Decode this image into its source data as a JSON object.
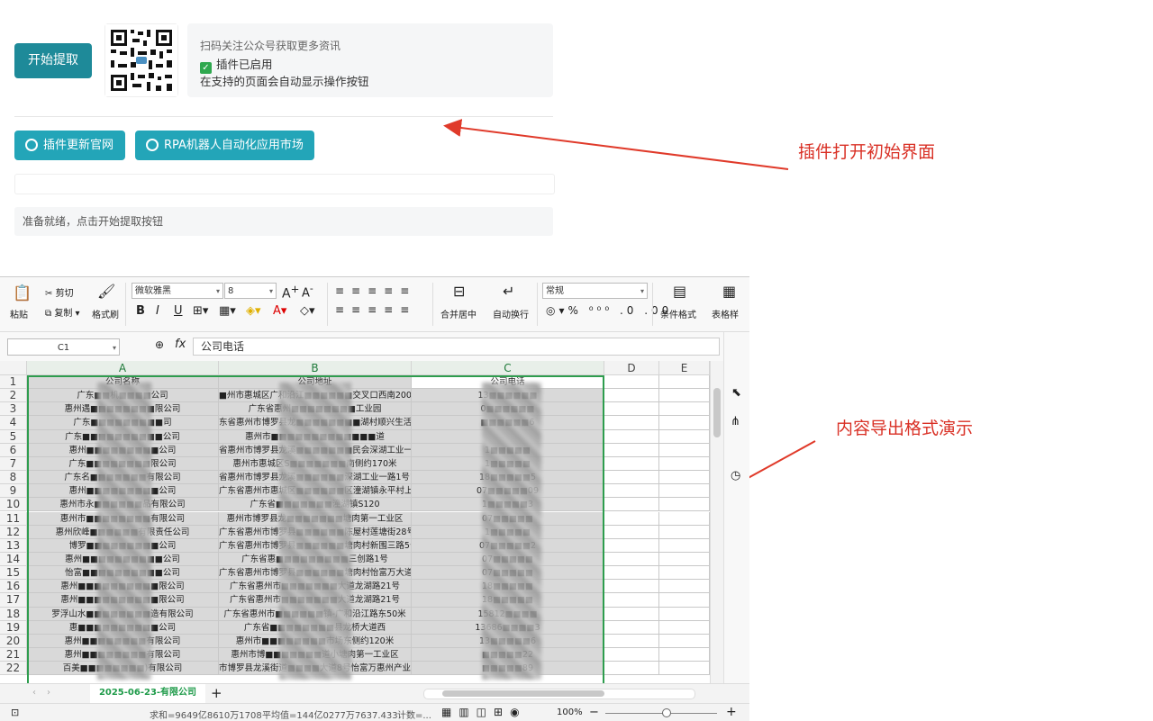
{
  "plugin": {
    "start_button": "开始提取",
    "info_line1": "扫码关注公众号获取更多资讯",
    "info_line2": "插件已启用",
    "info_line3": "在支持的页面会自动显示操作按钮",
    "link1": "插件更新官网",
    "link2": "RPA机器人自动化应用市场",
    "status": "准备就绪，点击开始提取按钮"
  },
  "callouts": {
    "top": "插件打开初始界面",
    "bottom": "内容导出格式演示"
  },
  "excel": {
    "ribbon": {
      "paste": "粘贴",
      "cut": "剪切",
      "copy": "复制",
      "format_painter": "格式刷",
      "font": "微软雅黑",
      "size": "8",
      "merge": "合并居中",
      "wrap": "自动换行",
      "number_format": "常规",
      "cond_format": "条件格式",
      "table_style": "表格样"
    },
    "cell_ref": "C1",
    "fx": "fx",
    "formula": "公司电话",
    "columns": [
      "A",
      "B",
      "C",
      "D",
      "E"
    ],
    "header_row": [
      "公司名称",
      "公司地址",
      "公司电话"
    ],
    "rows": [
      [
        "广东■■机■■■■公司",
        "■州市惠城区广和沿江■■■■■■交叉口西南200米",
        "13■■■■■■"
      ],
      [
        "惠州遇■■■■■■■■限公司",
        "广东省惠州■■■■■■■■工业园",
        "0■■■■■■"
      ],
      [
        "广东■■■■■■■■■司",
        "东省惠州市博罗县龙■■■■■■■■湖村顺兴生活超",
        "■■■■■■6"
      ],
      [
        "广东■■■■■■■■■■公司",
        "惠州市■■■■■■■■■■■■■道",
        ""
      ],
      [
        "惠州■■■■■■■■■公司",
        "省惠州市博罗县龙溪■■■■■■■民会深湖工业一■",
        "1■■■■■"
      ],
      [
        "广东■■■■■■■■限公司",
        "惠州市惠城区S■■■■■■■南侧约170米",
        "1■■■■■"
      ],
      [
        "广东名■■■■■■■有限公司",
        "省惠州市博罗县龙溪■■■■■■深湖工业一路1号1号",
        "18■■■■■5"
      ],
      [
        "惠州■■■■■■■■■公司",
        "广东省惠州市惠城区■■■■■■区潼湖镇永平村上村",
        "07■■■■■09"
      ],
      [
        "惠州市永■■■■■■品有限公司",
        "广东省■■■■■■■潼湖镇S120",
        "1■■■■■3"
      ],
      [
        "惠州市■■■■■■■■有限公司",
        "惠州市博罗县龙■■■■■■■塘肉第一工业区",
        "07■■■■■"
      ],
      [
        "惠州欣峰■■■■■■有限责任公司",
        "广东省惠州市博罗县■■■■■■陈屋村莲塘街28号",
        "1■■■■■"
      ],
      [
        "博罗■■■■■■■■■公司",
        "广东省惠州市博罗县■■■■■■塘肉村新围三路5号",
        "07■■■■■2"
      ],
      [
        "惠州■■■■■■■■■■公司",
        "广东省惠■■■■■■■■■三创路1号",
        "07■■■■■"
      ],
      [
        "怡富■■■■■■■■■■公司",
        "广东省惠州市博罗县■■■■■■塘肉村怡富万大道2号",
        "07■■■■■"
      ],
      [
        "惠州■■■■■■■■■■限公司",
        "广东省惠州市■■■■■■■大道龙湖路21号",
        "18■■■■■"
      ],
      [
        "惠州■■■■■■■■■■限公司",
        "广东省惠州市■■■■■■■大道龙湖路21号",
        "18■■■■■"
      ],
      [
        "罗浮山水■■■■■■■■造有限公司",
        "广东省惠州市■■■■■■镇-广和沿江路东50米",
        "15812■■■■"
      ],
      [
        "惠■■■■■■■■■■公司",
        "广东省■■■■■■■■县龙桥大道西",
        "13686■■■■3"
      ],
      [
        "惠州■■■■■■■■有限公司",
        "惠州市■■■■■■■■市场东侧约120米",
        "13■■■■■6"
      ],
      [
        "惠州■■■■■■■■有限公司",
        "惠州市博■■■■■■■道小塘肉第一工业区",
        "■■■■■22"
      ],
      [
        "百美■■■■■■■■)有限公司",
        "市博罗县龙溪街道■■■■大道8号怡富万惠州产业园6",
        "■■■■■89"
      ]
    ],
    "sheet_tab": "2025-06-23-有限公司",
    "status_sum": "求和=9649亿8610万1708",
    "status_avg": "平均值=144亿0277万7637.433",
    "status_count": "计数=...",
    "zoom": "100%"
  }
}
